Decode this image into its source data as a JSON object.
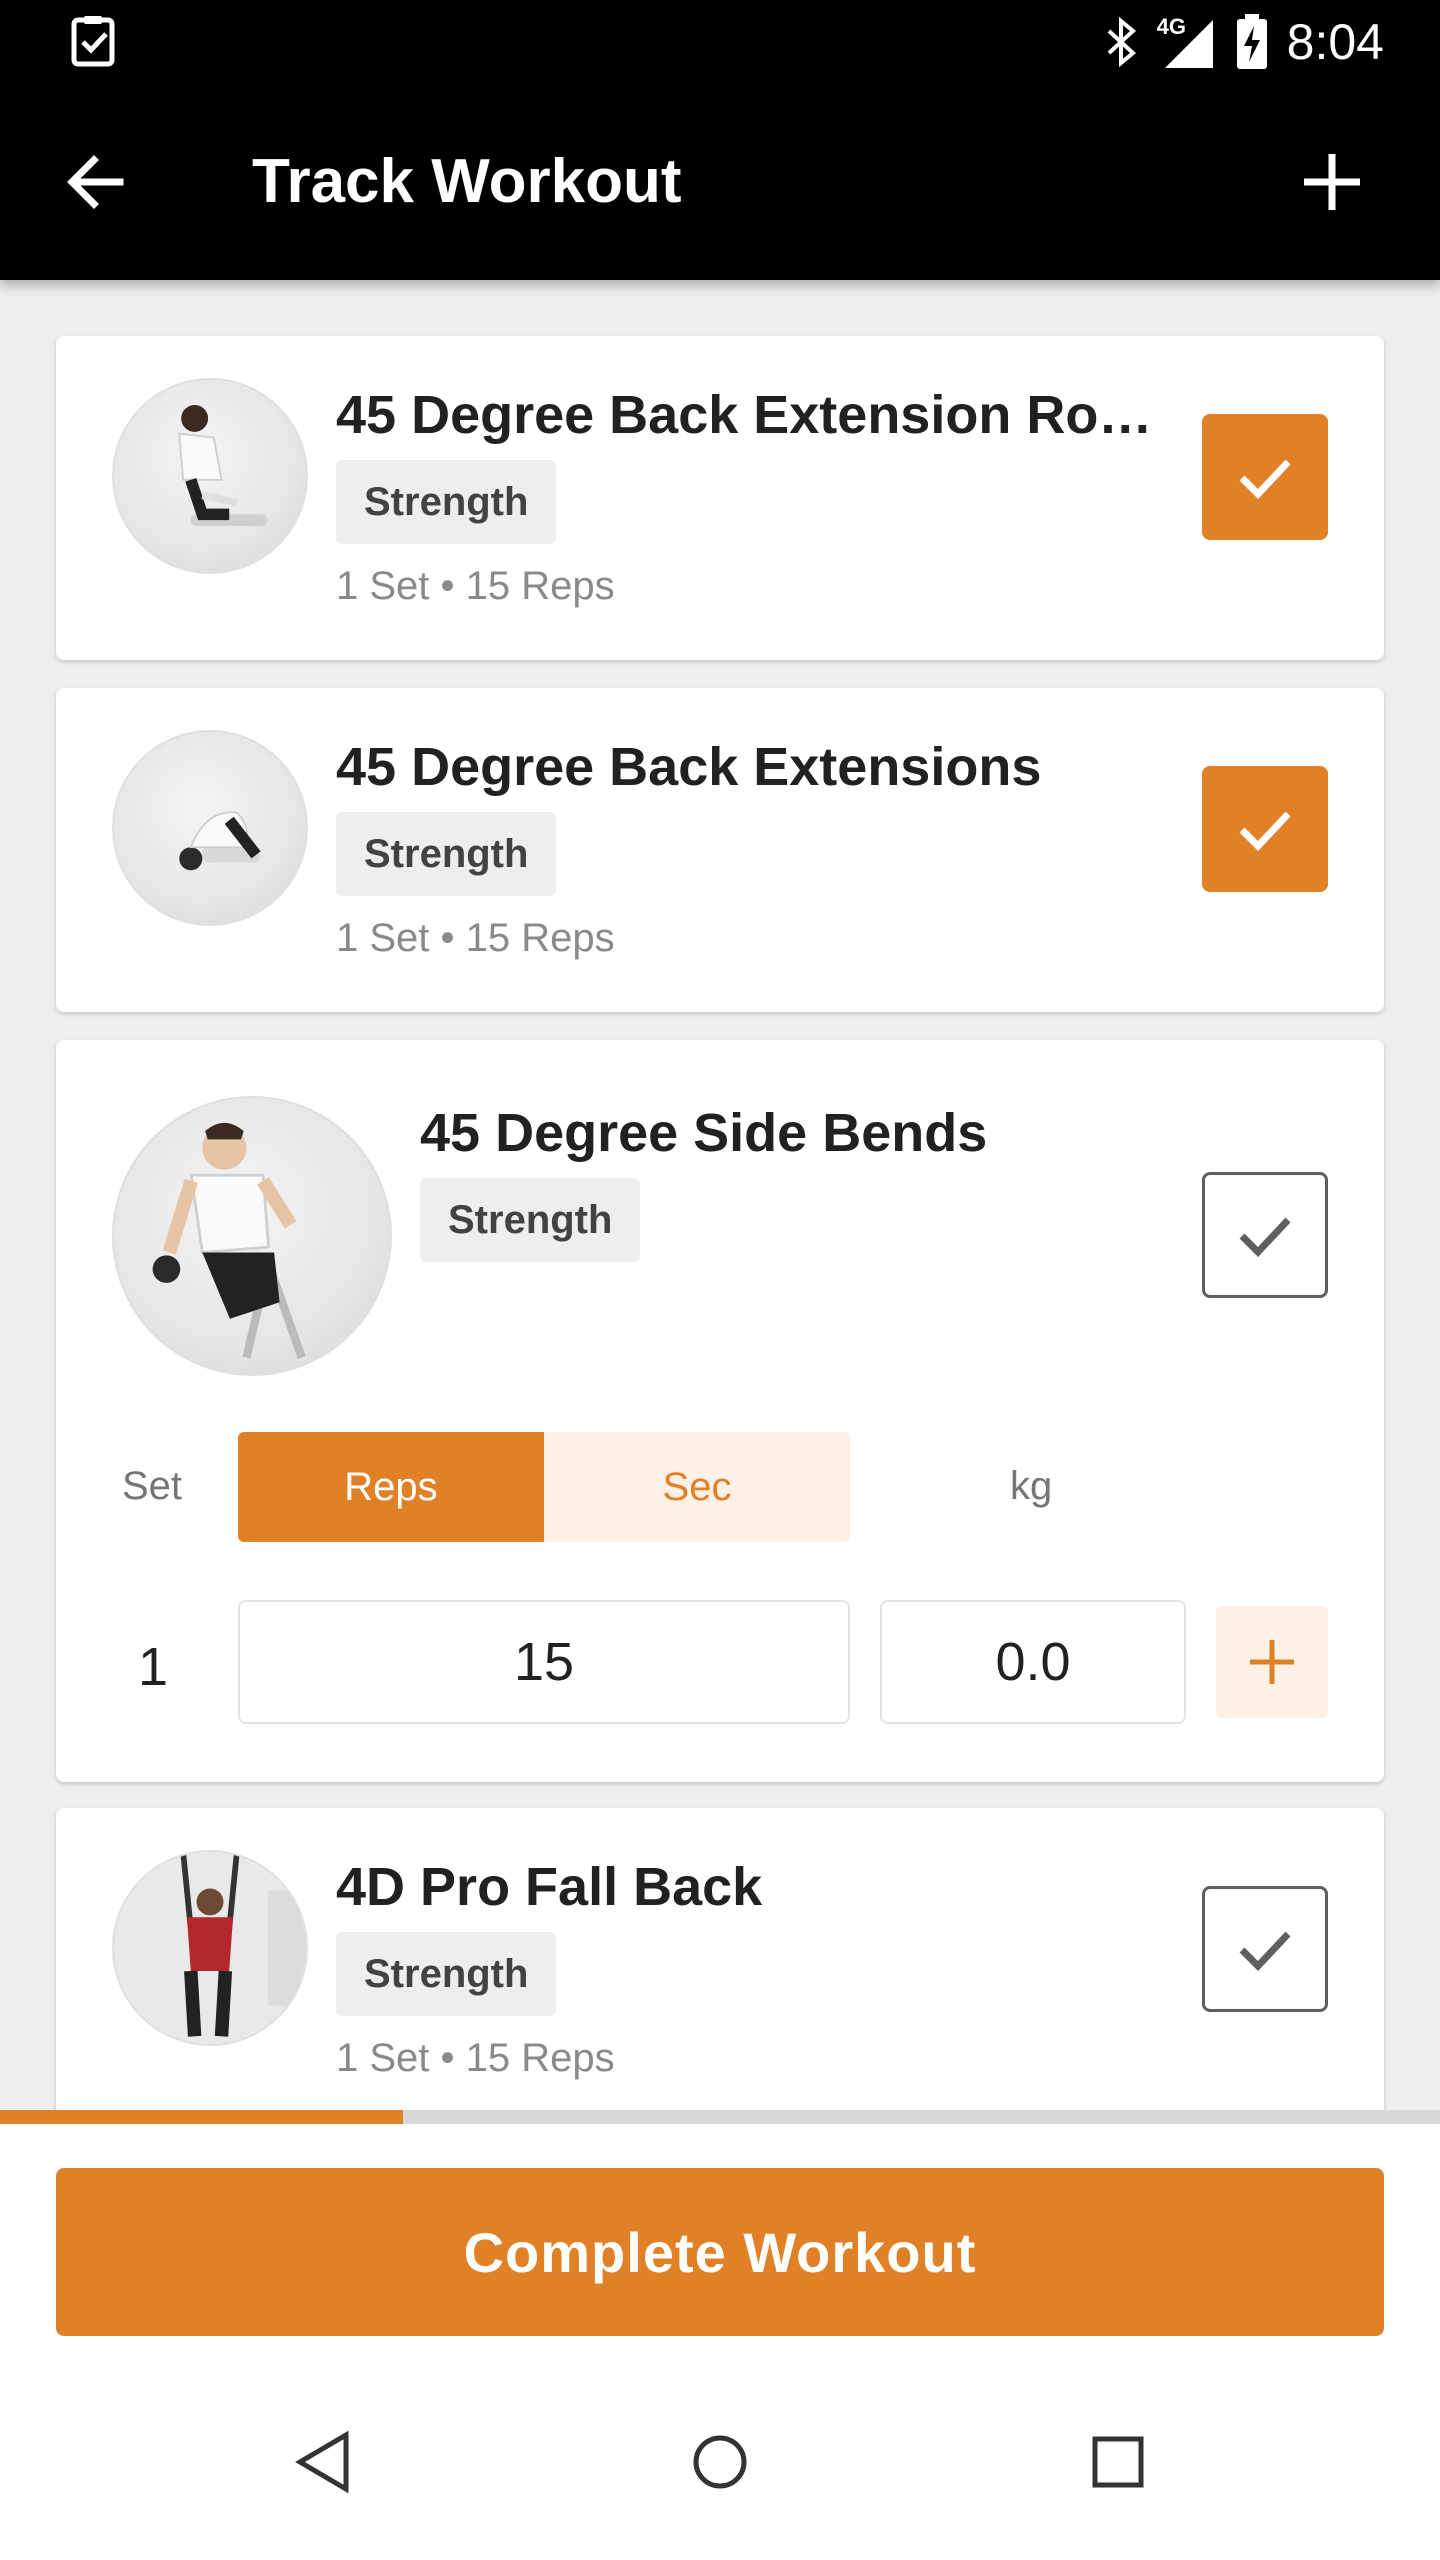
{
  "status_bar": {
    "time": "8:04",
    "network": "4G",
    "icons": [
      "clipboard-check-icon",
      "bluetooth-icon",
      "signal-icon",
      "battery-charging-icon"
    ]
  },
  "app_bar": {
    "title": "Track Workout",
    "back_icon": "arrow-back-icon",
    "add_icon": "plus-icon"
  },
  "exercises": [
    {
      "name": "45 Degree Back Extension Ro…",
      "category": "Strength",
      "summary": "1 Set • 15 Reps",
      "completed": true
    },
    {
      "name": "45 Degree Back Extensions",
      "category": "Strength",
      "summary": "1 Set • 15 Reps",
      "completed": true
    },
    {
      "name": "45 Degree Side Bends",
      "category": "Strength",
      "completed": false,
      "expanded": {
        "set_label": "Set",
        "mode_options": [
          "Reps",
          "Sec"
        ],
        "selected_mode": "Reps",
        "weight_unit": "kg",
        "sets": [
          {
            "number": "1",
            "reps": "15",
            "weight": "0.0"
          }
        ]
      }
    },
    {
      "name": "4D Pro Fall Back",
      "category": "Strength",
      "summary": "1 Set • 15 Reps",
      "completed": false
    }
  ],
  "progress": {
    "fraction": 0.28
  },
  "footer": {
    "complete_label": "Complete Workout"
  },
  "colors": {
    "accent": "#e08128",
    "accent_light": "#fdf0e6",
    "bar": "#000000"
  }
}
